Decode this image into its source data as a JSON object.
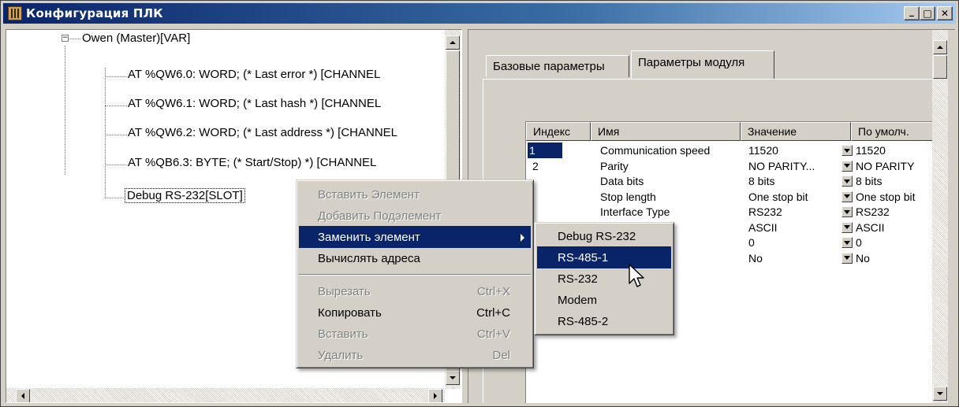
{
  "window": {
    "title": "Конфигурация ПЛК",
    "buttons": {
      "minimize": "_",
      "maximize": "□",
      "close": "✕"
    }
  },
  "tree": {
    "root": "Owen (Master)[VAR]",
    "items": [
      "AT %QW6.0: WORD; (* Last error *) [CHANNEL",
      "AT %QW6.1: WORD; (* Last hash *) [CHANNEL",
      "AT %QW6.2: WORD; (* Last address *) [CHANNEL",
      "AT %QB6.3: BYTE; (* Start/Stop) *) [CHANNEL",
      "Debug RS-232[SLOT]"
    ]
  },
  "tabs": [
    {
      "label": "Базовые параметры"
    },
    {
      "label": "Параметры модуля"
    }
  ],
  "grid": {
    "headers": [
      "Индекс",
      "Имя",
      "Значение",
      "По умолч."
    ],
    "rows": [
      {
        "index": "1",
        "name": "Communication speed",
        "value": "11520",
        "default": "11520"
      },
      {
        "index": "2",
        "name": "Parity",
        "value": "NO PARITY...",
        "default": "NO PARITY"
      },
      {
        "index": "",
        "name": "Data bits",
        "value": "8 bits",
        "default": "8 bits"
      },
      {
        "index": "",
        "name": "Stop length",
        "value": "One stop bit",
        "default": "One stop bit"
      },
      {
        "index": "",
        "name": "Interface Type",
        "value": "RS232",
        "default": "RS232"
      },
      {
        "index": "",
        "name": "ed",
        "value": "ASCII",
        "default": "ASCII"
      },
      {
        "index": "",
        "name": "ms",
        "value": "0",
        "default": "0"
      },
      {
        "index": "",
        "name": "",
        "value": "No",
        "default": "No"
      }
    ]
  },
  "context_menu": {
    "items": [
      {
        "label": "Вставить Элемент",
        "shortcut": ""
      },
      {
        "label": "Добавить Подэлемент",
        "shortcut": ""
      },
      {
        "label": "Заменить элемент",
        "shortcut": ""
      },
      {
        "label": "Вычислять адреса",
        "shortcut": ""
      },
      {
        "label": "Вырезать",
        "shortcut": "Ctrl+X"
      },
      {
        "label": "Копировать",
        "shortcut": "Ctrl+C"
      },
      {
        "label": "Вставить",
        "shortcut": "Ctrl+V"
      },
      {
        "label": "Удалить",
        "shortcut": "Del"
      }
    ]
  },
  "submenu": {
    "items": [
      "Debug RS-232",
      "RS-485-1",
      "RS-232",
      "Modem",
      "RS-485-2"
    ]
  },
  "colors": {
    "highlight": "#0a246a",
    "face": "#d4d0c8",
    "disabled": "#808080"
  }
}
